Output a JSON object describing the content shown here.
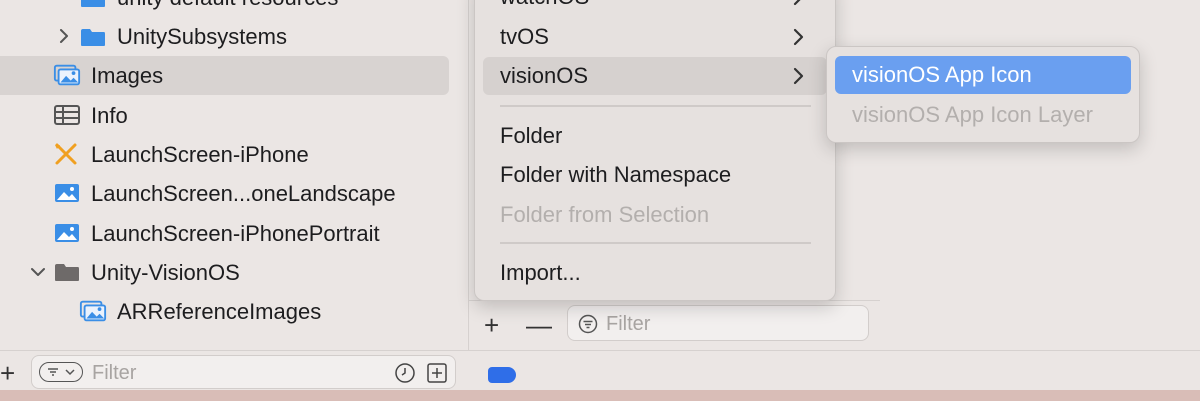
{
  "navigator": {
    "rows": [
      {
        "label": "unity default resources"
      },
      {
        "label": "UnitySubsystems"
      },
      {
        "label": "Images"
      },
      {
        "label": "Info"
      },
      {
        "label": "LaunchScreen-iPhone"
      },
      {
        "label": "LaunchScreen...oneLandscape"
      },
      {
        "label": "LaunchScreen-iPhonePortrait"
      },
      {
        "label": "Unity-VisionOS"
      },
      {
        "label": "ARReferenceImages"
      }
    ],
    "filter_placeholder": "Filter"
  },
  "column2": {
    "filter_placeholder": "Filter",
    "add_symbol": "+",
    "remove_symbol": "—"
  },
  "bottombar": {
    "add_symbol": "+"
  },
  "menu": {
    "items": [
      {
        "label": "watchOS"
      },
      {
        "label": "tvOS"
      },
      {
        "label": "visionOS"
      },
      {
        "label": "Folder"
      },
      {
        "label": "Folder with Namespace"
      },
      {
        "label": "Folder from Selection"
      },
      {
        "label": "Import..."
      }
    ]
  },
  "submenu": {
    "items": [
      {
        "label": "visionOS App Icon"
      },
      {
        "label": "visionOS App Icon Layer"
      }
    ]
  },
  "colors": {
    "accent_blue": "#2f6ee8",
    "highlight_blue": "#6a9ff0",
    "folder_blue": "#3a8ee6"
  },
  "icons": {
    "folder": "folder-icon",
    "image_set": "image-set-icon",
    "plist": "plist-icon",
    "storyboard": "storyboard-icon",
    "disclosure": "chevron-icon"
  }
}
